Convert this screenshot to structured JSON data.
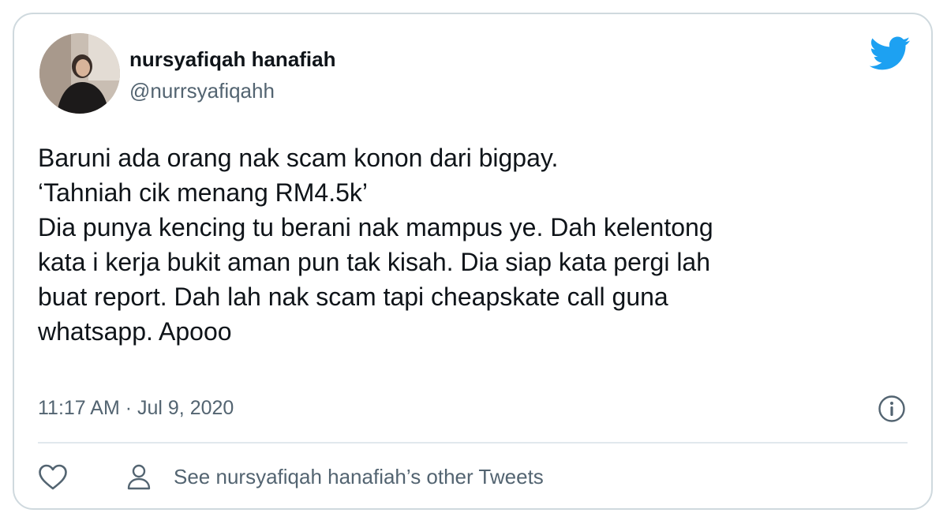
{
  "tweet": {
    "author_name": "nursyafiqah hanafiah",
    "author_handle": "@nurrsyafiqahh",
    "text": "Baruni ada orang nak scam konon dari bigpay.\n‘Tahniah cik menang RM4.5k’\nDia punya kencing tu berani nak mampus ye. Dah kelentong\nkata i kerja bukit aman pun tak kisah. Dia siap kata pergi lah\nbuat report. Dah lah nak scam tapi cheapskate call guna\nwhatsapp. Apooo",
    "timestamp": "11:17 AM · Jul 9, 2020"
  },
  "footer": {
    "other_tweets_label": "See nursyafiqah hanafiah’s other Tweets"
  },
  "icons": {
    "brand": "twitter-bird-icon",
    "info": "info-icon",
    "like": "heart-icon",
    "profile": "person-icon"
  },
  "colors": {
    "twitter_blue": "#1da1f2",
    "secondary_text": "#536471",
    "primary_text": "#0f1419",
    "border": "#cfd9de"
  }
}
